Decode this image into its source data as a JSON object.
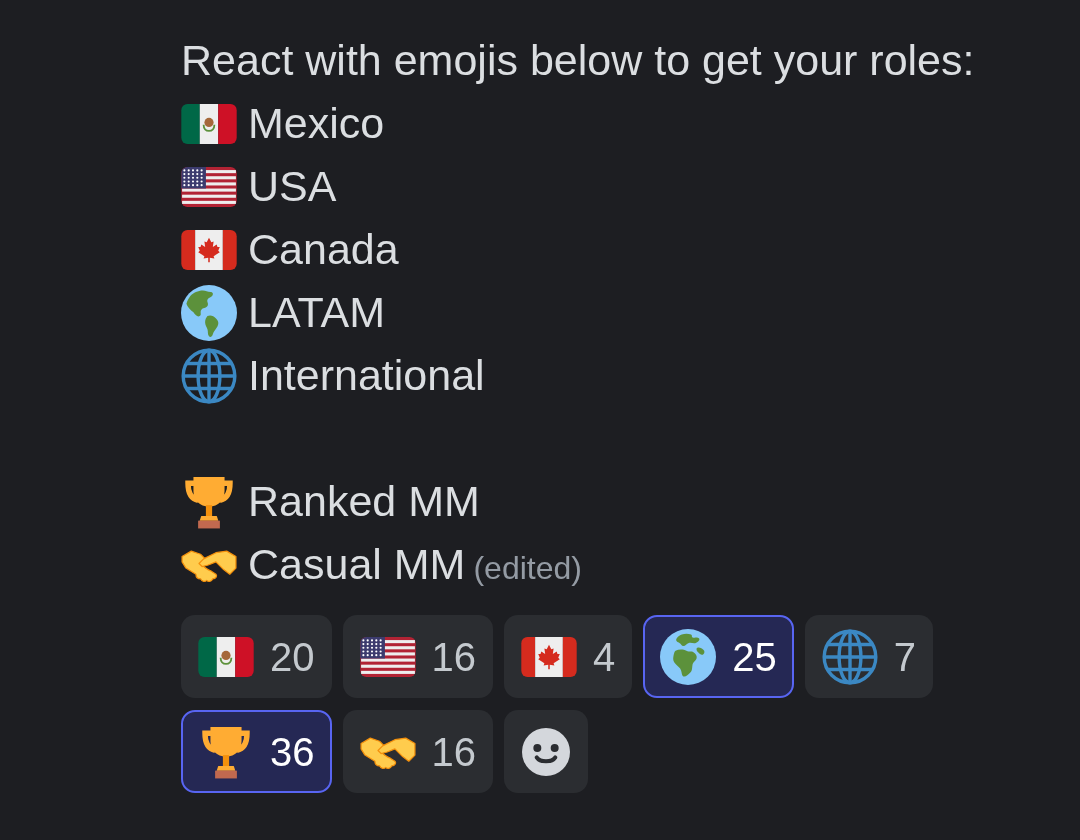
{
  "message": {
    "intro": "React with emojis below to get your roles:",
    "groups": [
      {
        "roles": [
          {
            "kind": "mexico",
            "label": "Mexico"
          },
          {
            "kind": "usa",
            "label": "USA"
          },
          {
            "kind": "canada",
            "label": "Canada"
          },
          {
            "kind": "americas",
            "label": "LATAM"
          },
          {
            "kind": "meridians",
            "label": "International"
          }
        ]
      },
      {
        "roles": [
          {
            "kind": "trophy",
            "label": "Ranked MM"
          },
          {
            "kind": "handshake",
            "label": "Casual MM"
          }
        ]
      }
    ],
    "edited_label": "(edited)"
  },
  "reactions": [
    {
      "kind": "mexico",
      "count": "20",
      "selected": false
    },
    {
      "kind": "usa",
      "count": "16",
      "selected": false
    },
    {
      "kind": "canada",
      "count": "4",
      "selected": false
    },
    {
      "kind": "europe",
      "count": "25",
      "selected": true
    },
    {
      "kind": "meridians",
      "count": "7",
      "selected": false
    },
    {
      "kind": "trophy",
      "count": "36",
      "selected": true
    },
    {
      "kind": "handshake",
      "count": "16",
      "selected": false
    }
  ],
  "add_reaction_button": true
}
